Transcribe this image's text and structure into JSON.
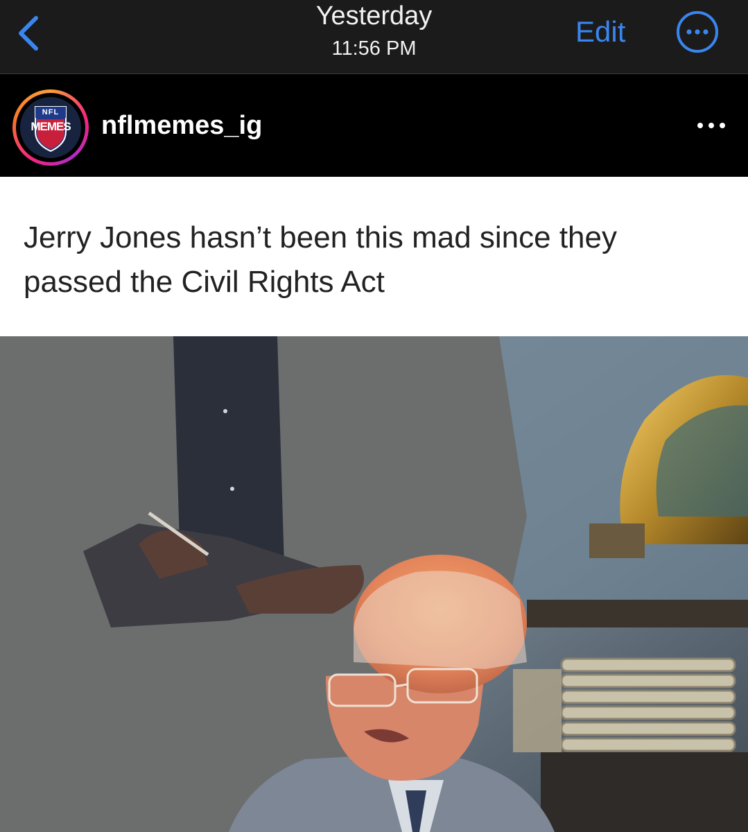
{
  "navbar": {
    "date": "Yesterday",
    "time": "11:56 PM",
    "edit_label": "Edit",
    "back_icon": "chevron-left-icon",
    "more_icon": "ellipsis-circle-icon",
    "accent_color": "#3a86f0"
  },
  "post": {
    "username": "nflmemes_ig",
    "avatar": {
      "top_text": "NFL",
      "main_text": "MEMES"
    },
    "more_icon": "ellipsis-icon",
    "caption": "Jerry Jones hasn’t been this mad since they passed the Civil Rights Act"
  }
}
